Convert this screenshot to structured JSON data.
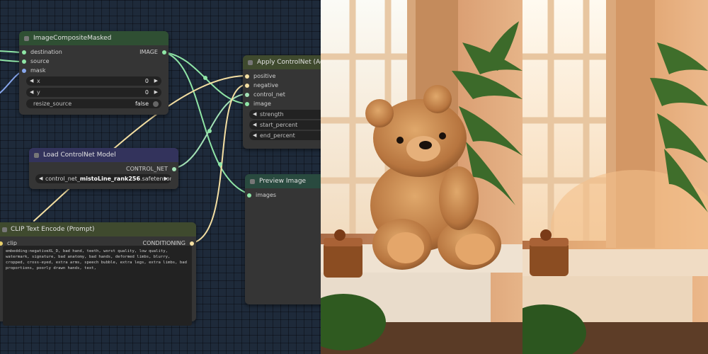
{
  "colors": {
    "image_wire": "#8fe6a6",
    "conditioning_wire": "#f4dfa2",
    "mask_wire": "#87a6ec"
  },
  "nodes": {
    "composite": {
      "title": "ImageCompositeMasked",
      "inputs": [
        "destination",
        "source",
        "mask"
      ],
      "output": "IMAGE",
      "x_label": "x",
      "x_value": "0",
      "y_label": "y",
      "y_value": "0",
      "resize_label": "resize_source",
      "resize_value": "false"
    },
    "apply_controlnet": {
      "title": "Apply ControlNet (Adv",
      "inputs": [
        "positive",
        "negative",
        "control_net",
        "image"
      ],
      "widgets": [
        "strength",
        "start_percent",
        "end_percent"
      ]
    },
    "load_controlnet": {
      "title": "Load ControlNet Model",
      "output": "CONTROL_NET",
      "model_prefix": "control_net_",
      "model_bold": "mistoLine_rank256",
      "model_suffix": ".safetensors"
    },
    "preview": {
      "title": "Preview Image",
      "input": "images"
    },
    "clip_text": {
      "title": "CLIP Text Encode (Prompt)",
      "input": "clip",
      "output": "CONDITIONING",
      "prompt": "embedding:negativeXL_D, bad hand, teeth, worst quality, low quality, watermark, signature, bad anatomy, bad hands, deformed limbs, blurry, cropped, cross-eyed, extra arms, speech bubble, extra legs, extra limbs, bad proportions, poorly drawn hands, text,"
    }
  },
  "previews": {
    "left_subject": "teddy bear on windowsill",
    "right_subject": "empty windowsill"
  }
}
